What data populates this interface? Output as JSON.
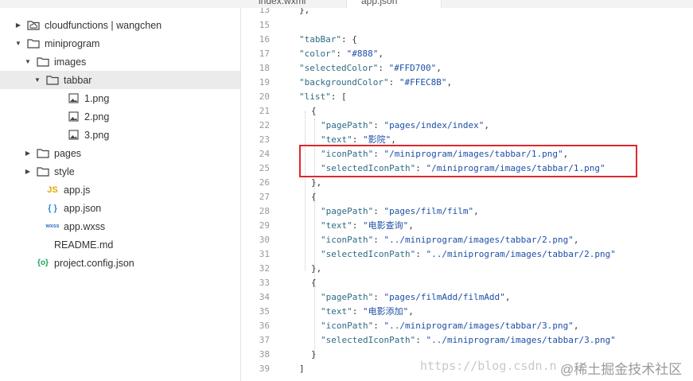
{
  "tabs": [
    {
      "label": "index.wxml"
    },
    {
      "label": "app.json"
    }
  ],
  "tree": [
    {
      "label": "cloudfunctions | wangchen",
      "icon": "cloud-folder-icon",
      "arrow": "right"
    },
    {
      "label": "miniprogram",
      "icon": "folder-icon",
      "arrow": "down"
    },
    {
      "label": "images",
      "icon": "folder-icon",
      "arrow": "down"
    },
    {
      "label": "tabbar",
      "icon": "folder-icon",
      "arrow": "down"
    },
    {
      "label": "1.png",
      "icon": "image-file-icon",
      "arrow": ""
    },
    {
      "label": "2.png",
      "icon": "image-file-icon",
      "arrow": ""
    },
    {
      "label": "3.png",
      "icon": "image-file-icon",
      "arrow": ""
    },
    {
      "label": "pages",
      "icon": "folder-icon",
      "arrow": "right"
    },
    {
      "label": "style",
      "icon": "folder-icon",
      "arrow": "right"
    },
    {
      "label": "app.js",
      "icon": "js-file-icon",
      "arrow": ""
    },
    {
      "label": "app.json",
      "icon": "json-file-icon",
      "arrow": ""
    },
    {
      "label": "app.wxss",
      "icon": "wxss-file-icon",
      "arrow": ""
    },
    {
      "label": "README.md",
      "icon": "markdown-file-icon",
      "arrow": ""
    },
    {
      "label": "project.config.json",
      "icon": "config-file-icon",
      "arrow": ""
    }
  ],
  "icon_badges": {
    "js": "JS",
    "json": "{ }",
    "wxss": "wxss",
    "config": "{o}"
  },
  "code": {
    "first_line_number": 13,
    "lines": [
      "},",
      "",
      "\"tabBar\": {",
      "\"color\": \"#888\",",
      "\"selectedColor\": \"#FFD700\",",
      "\"backgroundColor\": \"#FFEC8B\",",
      "\"list\": [",
      "{",
      "\"pagePath\": \"pages/index/index\",",
      "\"text\": \"影院\",",
      "\"iconPath\": \"/miniprogram/images/tabbar/1.png\",",
      "\"selectedIconPath\": \"/miniprogram/images/tabbar/1.png\"",
      "},",
      "{",
      "\"pagePath\": \"pages/film/film\",",
      "\"text\": \"电影查询\",",
      "\"iconPath\": \"../miniprogram/images/tabbar/2.png\",",
      "\"selectedIconPath\": \"../miniprogram/images/tabbar/2.png\"",
      "},",
      "{",
      "\"pagePath\": \"pages/filmAdd/filmAdd\",",
      "\"text\": \"电影添加\",",
      "\"iconPath\": \"../miniprogram/images/tabbar/3.png\",",
      "\"selectedIconPath\": \"../miniprogram/images/tabbar/3.png\"",
      "}",
      "]"
    ],
    "line_numbers": [
      "13",
      "15",
      "16",
      "17",
      "18",
      "19",
      "20",
      "21",
      "22",
      "23",
      "24",
      "25",
      "26",
      "27",
      "28",
      "29",
      "30",
      "31",
      "32",
      "33",
      "34",
      "35",
      "36",
      "37",
      "38",
      "39"
    ]
  },
  "watermark": {
    "url": "https://blog.csdn.n",
    "site": "@稀土掘金技术社区"
  },
  "colors": {
    "highlight_box": "#e0272c",
    "selected_row": "#ebebeb",
    "string": "#1d4fa6",
    "key": "#2e6b85"
  }
}
